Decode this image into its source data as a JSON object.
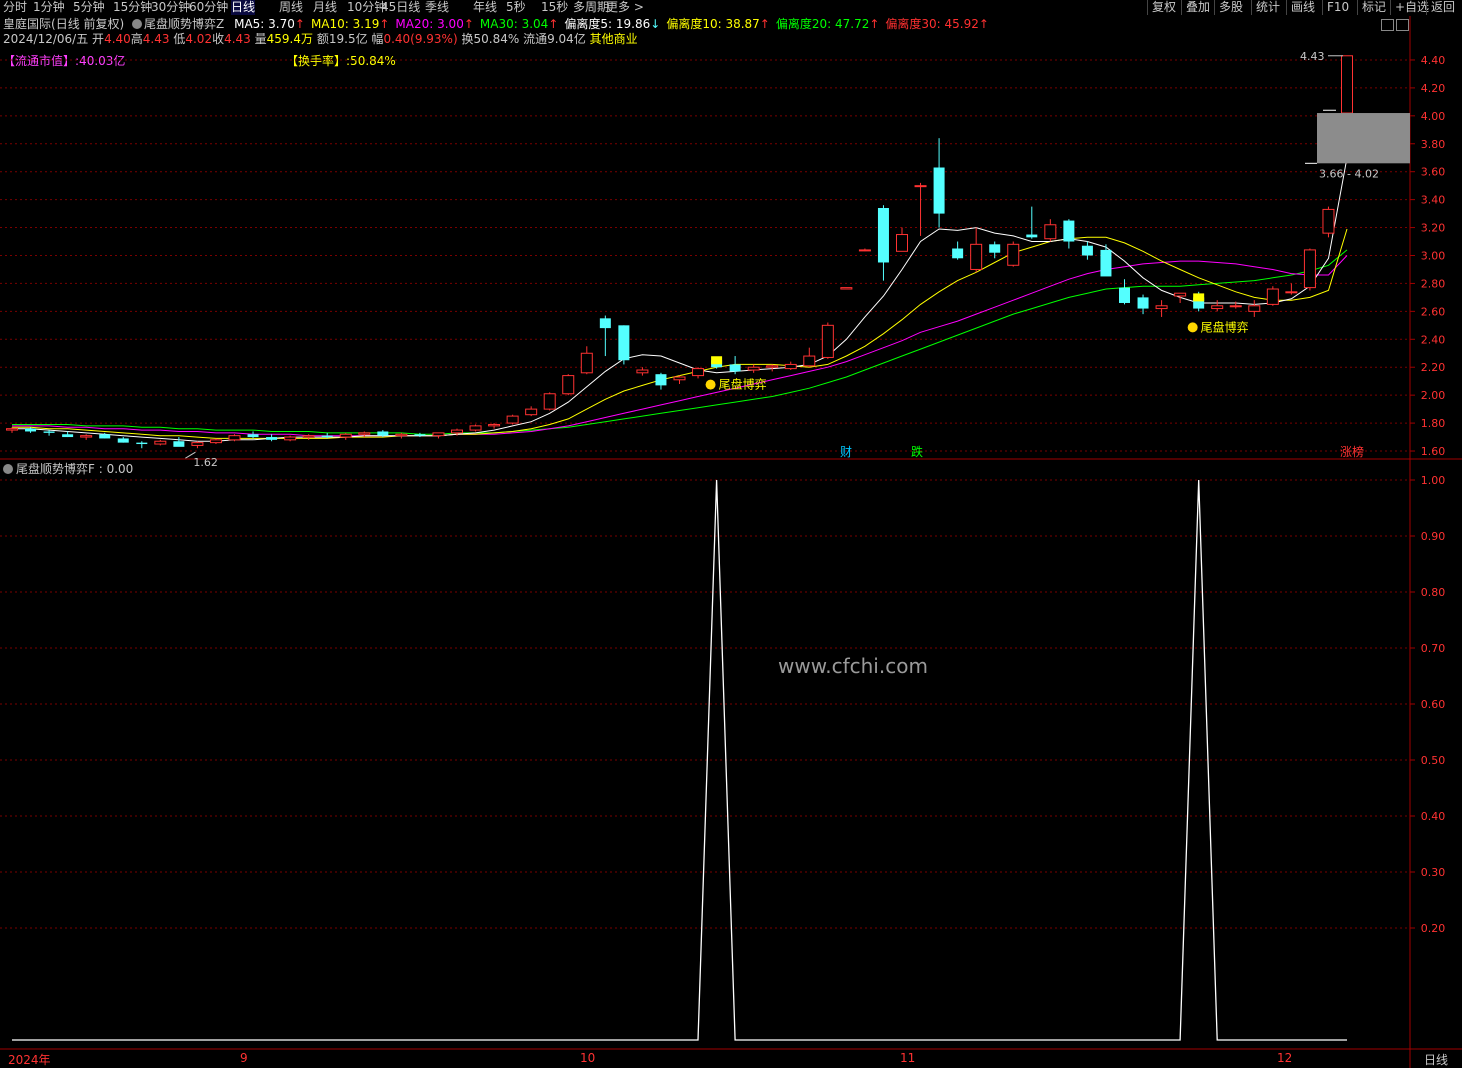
{
  "toolbar": {
    "periods": [
      "分时",
      "1分钟",
      "5分钟",
      "15分钟",
      "30分钟",
      "60分钟",
      "日线",
      "周线",
      "月线",
      "10分钟",
      "45日线",
      "季线",
      "年线",
      "5秒",
      "15秒",
      "多周期",
      "更多 >"
    ],
    "active_period": "日线",
    "right_buttons": [
      "复权",
      "叠加",
      "多股",
      "统计",
      "画线",
      "F10",
      "标记",
      "+自选",
      "返回"
    ]
  },
  "header": {
    "stock_name": "皇庭国际",
    "period_info": "(日线 前复权)",
    "indicator_name": "尾盘顺势博弈Z",
    "ma": [
      {
        "label": "MA5: 3.70",
        "arrow": "↑",
        "color": "#ffffff"
      },
      {
        "label": "MA10: 3.19",
        "arrow": "↑",
        "color": "#ffff00"
      },
      {
        "label": "MA20: 3.00",
        "arrow": "↑",
        "color": "#ff00ff"
      },
      {
        "label": "MA30: 3.04",
        "arrow": "↑",
        "color": "#00ff00"
      },
      {
        "label": "偏离度5: 19.86",
        "arrow": "↓",
        "color": "#ffffff"
      },
      {
        "label": "偏离度10: 38.87",
        "arrow": "↑",
        "color": "#ffff00"
      },
      {
        "label": "偏离度20: 47.72",
        "arrow": "↑",
        "color": "#00ff00"
      },
      {
        "label": "偏离度30: 45.92",
        "arrow": "↑",
        "color": "#ff3030"
      }
    ],
    "quote": {
      "date": "2024/12/06/五",
      "open_label": "开",
      "open": "4.40",
      "high_label": "高",
      "high": "4.43",
      "low_label": "低",
      "low": "4.02",
      "close_label": "收",
      "close": "4.43",
      "vol_label": "量",
      "vol": "459.4万",
      "amount_label": "额",
      "amount": "19.5亿",
      "range_label": "幅",
      "range": "0.40(9.93%)",
      "turnover_label": "换",
      "turnover": "50.84%",
      "float_label": "流通",
      "float": "9.04亿",
      "sector": "其他商业"
    },
    "float_mv_label": "【流通市值】",
    "float_mv_value": ":40.03亿",
    "turnover_rate_label": "【换手率】",
    "turnover_rate_value": ":50.84%"
  },
  "price_axis": [
    "4.40",
    "4.20",
    "4.00",
    "3.80",
    "3.60",
    "3.40",
    "3.20",
    "3.00",
    "2.80",
    "2.60",
    "2.40",
    "2.20",
    "2.00",
    "1.80",
    "1.60"
  ],
  "annotations": {
    "high_marker": "4.43",
    "low_marker": "1.62",
    "zone_range": "3.66 - 4.02",
    "signal_text_1": "尾盘博弈",
    "signal_text_2": "尾盘博弈",
    "event_cai": "财",
    "event_die": "跌",
    "event_zhang": "涨榜"
  },
  "sub_panel": {
    "title": "尾盘顺势博弈F : 0.00",
    "axis": [
      "1.00",
      "0.90",
      "0.80",
      "0.70",
      "0.60",
      "0.50",
      "0.40",
      "0.30",
      "0.20"
    ]
  },
  "watermark": "www.cfchi.com",
  "time_axis": {
    "labels": [
      "2024年",
      "9",
      "10",
      "11",
      "12"
    ],
    "period_tab": "日线"
  },
  "colors": {
    "up": "#ff3232",
    "down": "#54ffff",
    "grid": "#7a0000",
    "border": "#a00000",
    "ma5": "#ffffff",
    "ma10": "#ffff00",
    "ma20": "#ff00ff",
    "ma30": "#00ff00"
  },
  "chart_data": {
    "type": "candlestick",
    "candles": [
      [
        1.75,
        1.77,
        1.73,
        1.76
      ],
      [
        1.76,
        1.77,
        1.73,
        1.74
      ],
      [
        1.74,
        1.75,
        1.71,
        1.73
      ],
      [
        1.72,
        1.74,
        1.7,
        1.7
      ],
      [
        1.7,
        1.72,
        1.68,
        1.71
      ],
      [
        1.72,
        1.73,
        1.69,
        1.69
      ],
      [
        1.69,
        1.7,
        1.66,
        1.66
      ],
      [
        1.66,
        1.67,
        1.62,
        1.65
      ],
      [
        1.65,
        1.68,
        1.64,
        1.67
      ],
      [
        1.67,
        1.7,
        1.64,
        1.63
      ],
      [
        1.64,
        1.67,
        1.62,
        1.66
      ],
      [
        1.66,
        1.69,
        1.65,
        1.68
      ],
      [
        1.68,
        1.72,
        1.67,
        1.71
      ],
      [
        1.72,
        1.74,
        1.69,
        1.7
      ],
      [
        1.7,
        1.72,
        1.67,
        1.68
      ],
      [
        1.68,
        1.71,
        1.67,
        1.7
      ],
      [
        1.7,
        1.72,
        1.68,
        1.71
      ],
      [
        1.71,
        1.73,
        1.69,
        1.7
      ],
      [
        1.7,
        1.73,
        1.68,
        1.72
      ],
      [
        1.72,
        1.74,
        1.7,
        1.73
      ],
      [
        1.74,
        1.75,
        1.7,
        1.71
      ],
      [
        1.71,
        1.73,
        1.69,
        1.72
      ],
      [
        1.72,
        1.73,
        1.7,
        1.71
      ],
      [
        1.71,
        1.73,
        1.69,
        1.73
      ],
      [
        1.73,
        1.76,
        1.71,
        1.75
      ],
      [
        1.75,
        1.79,
        1.74,
        1.78
      ],
      [
        1.78,
        1.8,
        1.76,
        1.79
      ],
      [
        1.8,
        1.86,
        1.79,
        1.85
      ],
      [
        1.86,
        1.92,
        1.85,
        1.9
      ],
      [
        1.9,
        2.02,
        1.89,
        2.01
      ],
      [
        2.01,
        2.15,
        2.0,
        2.14
      ],
      [
        2.16,
        2.35,
        2.15,
        2.3
      ],
      [
        2.55,
        2.57,
        2.28,
        2.48
      ],
      [
        2.5,
        2.5,
        2.22,
        2.25
      ],
      [
        2.16,
        2.2,
        2.14,
        2.18
      ],
      [
        2.15,
        2.16,
        2.04,
        2.07
      ],
      [
        2.11,
        2.14,
        2.08,
        2.13
      ],
      [
        2.14,
        2.2,
        2.12,
        2.19
      ],
      [
        2.25,
        2.26,
        2.19,
        2.2
      ],
      [
        2.22,
        2.28,
        2.15,
        2.17
      ],
      [
        2.18,
        2.22,
        2.16,
        2.2
      ],
      [
        2.2,
        2.22,
        2.17,
        2.21
      ],
      [
        2.19,
        2.24,
        2.18,
        2.22
      ],
      [
        2.21,
        2.34,
        2.2,
        2.28
      ],
      [
        2.27,
        2.52,
        2.26,
        2.5
      ],
      [
        2.76,
        2.77,
        2.76,
        2.77
      ],
      [
        3.04,
        3.05,
        3.03,
        3.04
      ],
      [
        3.34,
        3.36,
        2.82,
        2.95
      ],
      [
        3.03,
        3.2,
        3.04,
        3.15
      ],
      [
        3.5,
        3.52,
        3.14,
        3.5
      ],
      [
        3.63,
        3.84,
        3.2,
        3.3
      ],
      [
        3.05,
        3.1,
        2.97,
        2.98
      ],
      [
        2.9,
        3.2,
        2.88,
        3.08
      ],
      [
        3.08,
        3.1,
        2.98,
        3.02
      ],
      [
        2.93,
        3.1,
        2.92,
        3.08
      ],
      [
        3.15,
        3.35,
        3.12,
        3.13
      ],
      [
        3.12,
        3.26,
        3.1,
        3.22
      ],
      [
        3.25,
        3.26,
        3.05,
        3.1
      ],
      [
        3.07,
        3.1,
        2.97,
        3.0
      ],
      [
        3.04,
        3.08,
        2.86,
        2.85
      ],
      [
        2.77,
        2.83,
        2.65,
        2.66
      ],
      [
        2.7,
        2.72,
        2.58,
        2.62
      ],
      [
        2.62,
        2.68,
        2.56,
        2.64
      ],
      [
        2.71,
        2.73,
        2.66,
        2.73
      ],
      [
        2.7,
        2.74,
        2.6,
        2.62
      ],
      [
        2.62,
        2.68,
        2.6,
        2.64
      ],
      [
        2.64,
        2.67,
        2.62,
        2.64
      ],
      [
        2.6,
        2.68,
        2.56,
        2.64
      ],
      [
        2.65,
        2.78,
        2.64,
        2.76
      ],
      [
        2.74,
        2.8,
        2.72,
        2.74
      ],
      [
        2.77,
        3.05,
        2.75,
        3.04
      ],
      [
        3.16,
        3.35,
        3.13,
        3.33
      ],
      [
        4.02,
        4.43,
        3.66,
        4.43
      ]
    ],
    "ma5": [
      1.76,
      1.76,
      1.75,
      1.74,
      1.73,
      1.72,
      1.71,
      1.7,
      1.69,
      1.68,
      1.67,
      1.67,
      1.68,
      1.68,
      1.69,
      1.7,
      1.7,
      1.7,
      1.7,
      1.71,
      1.71,
      1.71,
      1.71,
      1.71,
      1.72,
      1.73,
      1.75,
      1.78,
      1.81,
      1.87,
      1.95,
      2.06,
      2.17,
      2.26,
      2.29,
      2.28,
      2.23,
      2.18,
      2.16,
      2.17,
      2.18,
      2.19,
      2.2,
      2.22,
      2.28,
      2.4,
      2.56,
      2.71,
      2.9,
      3.1,
      3.19,
      3.18,
      3.2,
      3.16,
      3.14,
      3.1,
      3.1,
      3.12,
      3.1,
      3.06,
      2.96,
      2.84,
      2.75,
      2.7,
      2.66,
      2.66,
      2.66,
      2.65,
      2.66,
      2.69,
      2.78,
      2.98,
      3.7
    ],
    "ma10": [
      1.77,
      1.77,
      1.76,
      1.76,
      1.75,
      1.74,
      1.73,
      1.72,
      1.71,
      1.71,
      1.7,
      1.69,
      1.69,
      1.69,
      1.69,
      1.69,
      1.69,
      1.69,
      1.7,
      1.7,
      1.7,
      1.71,
      1.71,
      1.71,
      1.72,
      1.72,
      1.73,
      1.74,
      1.76,
      1.79,
      1.83,
      1.9,
      1.97,
      2.03,
      2.07,
      2.11,
      2.14,
      2.17,
      2.2,
      2.22,
      2.22,
      2.22,
      2.21,
      2.2,
      2.22,
      2.28,
      2.35,
      2.44,
      2.54,
      2.65,
      2.74,
      2.82,
      2.88,
      2.95,
      3.02,
      3.06,
      3.1,
      3.12,
      3.13,
      3.13,
      3.09,
      3.03,
      2.96,
      2.9,
      2.84,
      2.79,
      2.74,
      2.7,
      2.68,
      2.68,
      2.7,
      2.75,
      3.19
    ],
    "ma20": [
      1.78,
      1.78,
      1.78,
      1.77,
      1.77,
      1.76,
      1.76,
      1.75,
      1.75,
      1.74,
      1.74,
      1.73,
      1.73,
      1.72,
      1.72,
      1.72,
      1.71,
      1.71,
      1.71,
      1.71,
      1.71,
      1.71,
      1.71,
      1.71,
      1.72,
      1.72,
      1.72,
      1.73,
      1.74,
      1.76,
      1.78,
      1.81,
      1.84,
      1.87,
      1.9,
      1.93,
      1.96,
      1.99,
      2.02,
      2.05,
      2.08,
      2.11,
      2.14,
      2.17,
      2.2,
      2.24,
      2.29,
      2.34,
      2.39,
      2.45,
      2.49,
      2.53,
      2.58,
      2.63,
      2.68,
      2.73,
      2.78,
      2.83,
      2.87,
      2.9,
      2.92,
      2.94,
      2.95,
      2.96,
      2.96,
      2.95,
      2.94,
      2.92,
      2.9,
      2.87,
      2.86,
      2.86,
      3.0
    ],
    "ma30": [
      1.79,
      1.79,
      1.79,
      1.79,
      1.78,
      1.78,
      1.78,
      1.77,
      1.77,
      1.76,
      1.76,
      1.75,
      1.75,
      1.75,
      1.74,
      1.74,
      1.74,
      1.73,
      1.73,
      1.73,
      1.73,
      1.73,
      1.72,
      1.72,
      1.73,
      1.73,
      1.73,
      1.74,
      1.75,
      1.76,
      1.77,
      1.79,
      1.81,
      1.83,
      1.85,
      1.87,
      1.89,
      1.91,
      1.93,
      1.95,
      1.97,
      1.99,
      2.02,
      2.05,
      2.09,
      2.13,
      2.18,
      2.23,
      2.28,
      2.33,
      2.38,
      2.43,
      2.48,
      2.53,
      2.58,
      2.62,
      2.66,
      2.7,
      2.73,
      2.76,
      2.77,
      2.78,
      2.78,
      2.78,
      2.79,
      2.8,
      2.81,
      2.82,
      2.84,
      2.86,
      2.89,
      2.93,
      3.04
    ],
    "signal_f": [
      0,
      0,
      0,
      0,
      0,
      0,
      0,
      0,
      0,
      0,
      0,
      0,
      0,
      0,
      0,
      0,
      0,
      0,
      0,
      0,
      0,
      0,
      0,
      0,
      0,
      0,
      0,
      0,
      0,
      0,
      0,
      0,
      0,
      0,
      0,
      0,
      0,
      0,
      1,
      0,
      0,
      0,
      0,
      0,
      0,
      0,
      0,
      0,
      0,
      0,
      0,
      0,
      0,
      0,
      0,
      0,
      0,
      0,
      0,
      0,
      0,
      0,
      0,
      0,
      1,
      0,
      0,
      0,
      0,
      0,
      0,
      0,
      0
    ],
    "ylim_main": [
      1.55,
      4.5
    ],
    "ylim_sub": [
      0,
      1
    ]
  }
}
